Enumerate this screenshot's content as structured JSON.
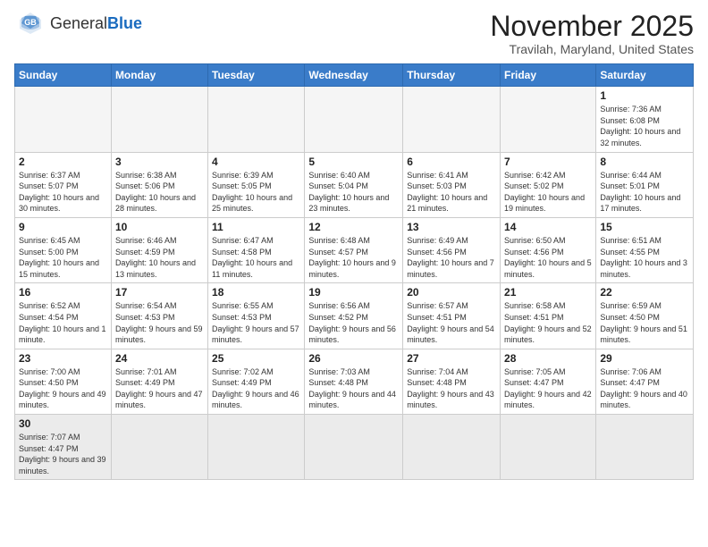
{
  "logo": {
    "general": "General",
    "blue": "Blue"
  },
  "header": {
    "month": "November 2025",
    "location": "Travilah, Maryland, United States"
  },
  "weekdays": [
    "Sunday",
    "Monday",
    "Tuesday",
    "Wednesday",
    "Thursday",
    "Friday",
    "Saturday"
  ],
  "weeks": [
    [
      {
        "day": "",
        "info": ""
      },
      {
        "day": "",
        "info": ""
      },
      {
        "day": "",
        "info": ""
      },
      {
        "day": "",
        "info": ""
      },
      {
        "day": "",
        "info": ""
      },
      {
        "day": "",
        "info": ""
      },
      {
        "day": "1",
        "info": "Sunrise: 7:36 AM\nSunset: 6:08 PM\nDaylight: 10 hours and 32 minutes."
      }
    ],
    [
      {
        "day": "2",
        "info": "Sunrise: 6:37 AM\nSunset: 5:07 PM\nDaylight: 10 hours and 30 minutes."
      },
      {
        "day": "3",
        "info": "Sunrise: 6:38 AM\nSunset: 5:06 PM\nDaylight: 10 hours and 28 minutes."
      },
      {
        "day": "4",
        "info": "Sunrise: 6:39 AM\nSunset: 5:05 PM\nDaylight: 10 hours and 25 minutes."
      },
      {
        "day": "5",
        "info": "Sunrise: 6:40 AM\nSunset: 5:04 PM\nDaylight: 10 hours and 23 minutes."
      },
      {
        "day": "6",
        "info": "Sunrise: 6:41 AM\nSunset: 5:03 PM\nDaylight: 10 hours and 21 minutes."
      },
      {
        "day": "7",
        "info": "Sunrise: 6:42 AM\nSunset: 5:02 PM\nDaylight: 10 hours and 19 minutes."
      },
      {
        "day": "8",
        "info": "Sunrise: 6:44 AM\nSunset: 5:01 PM\nDaylight: 10 hours and 17 minutes."
      }
    ],
    [
      {
        "day": "9",
        "info": "Sunrise: 6:45 AM\nSunset: 5:00 PM\nDaylight: 10 hours and 15 minutes."
      },
      {
        "day": "10",
        "info": "Sunrise: 6:46 AM\nSunset: 4:59 PM\nDaylight: 10 hours and 13 minutes."
      },
      {
        "day": "11",
        "info": "Sunrise: 6:47 AM\nSunset: 4:58 PM\nDaylight: 10 hours and 11 minutes."
      },
      {
        "day": "12",
        "info": "Sunrise: 6:48 AM\nSunset: 4:57 PM\nDaylight: 10 hours and 9 minutes."
      },
      {
        "day": "13",
        "info": "Sunrise: 6:49 AM\nSunset: 4:56 PM\nDaylight: 10 hours and 7 minutes."
      },
      {
        "day": "14",
        "info": "Sunrise: 6:50 AM\nSunset: 4:56 PM\nDaylight: 10 hours and 5 minutes."
      },
      {
        "day": "15",
        "info": "Sunrise: 6:51 AM\nSunset: 4:55 PM\nDaylight: 10 hours and 3 minutes."
      }
    ],
    [
      {
        "day": "16",
        "info": "Sunrise: 6:52 AM\nSunset: 4:54 PM\nDaylight: 10 hours and 1 minute."
      },
      {
        "day": "17",
        "info": "Sunrise: 6:54 AM\nSunset: 4:53 PM\nDaylight: 9 hours and 59 minutes."
      },
      {
        "day": "18",
        "info": "Sunrise: 6:55 AM\nSunset: 4:53 PM\nDaylight: 9 hours and 57 minutes."
      },
      {
        "day": "19",
        "info": "Sunrise: 6:56 AM\nSunset: 4:52 PM\nDaylight: 9 hours and 56 minutes."
      },
      {
        "day": "20",
        "info": "Sunrise: 6:57 AM\nSunset: 4:51 PM\nDaylight: 9 hours and 54 minutes."
      },
      {
        "day": "21",
        "info": "Sunrise: 6:58 AM\nSunset: 4:51 PM\nDaylight: 9 hours and 52 minutes."
      },
      {
        "day": "22",
        "info": "Sunrise: 6:59 AM\nSunset: 4:50 PM\nDaylight: 9 hours and 51 minutes."
      }
    ],
    [
      {
        "day": "23",
        "info": "Sunrise: 7:00 AM\nSunset: 4:50 PM\nDaylight: 9 hours and 49 minutes."
      },
      {
        "day": "24",
        "info": "Sunrise: 7:01 AM\nSunset: 4:49 PM\nDaylight: 9 hours and 47 minutes."
      },
      {
        "day": "25",
        "info": "Sunrise: 7:02 AM\nSunset: 4:49 PM\nDaylight: 9 hours and 46 minutes."
      },
      {
        "day": "26",
        "info": "Sunrise: 7:03 AM\nSunset: 4:48 PM\nDaylight: 9 hours and 44 minutes."
      },
      {
        "day": "27",
        "info": "Sunrise: 7:04 AM\nSunset: 4:48 PM\nDaylight: 9 hours and 43 minutes."
      },
      {
        "day": "28",
        "info": "Sunrise: 7:05 AM\nSunset: 4:47 PM\nDaylight: 9 hours and 42 minutes."
      },
      {
        "day": "29",
        "info": "Sunrise: 7:06 AM\nSunset: 4:47 PM\nDaylight: 9 hours and 40 minutes."
      }
    ],
    [
      {
        "day": "30",
        "info": "Sunrise: 7:07 AM\nSunset: 4:47 PM\nDaylight: 9 hours and 39 minutes."
      },
      {
        "day": "",
        "info": ""
      },
      {
        "day": "",
        "info": ""
      },
      {
        "day": "",
        "info": ""
      },
      {
        "day": "",
        "info": ""
      },
      {
        "day": "",
        "info": ""
      },
      {
        "day": "",
        "info": ""
      }
    ]
  ]
}
